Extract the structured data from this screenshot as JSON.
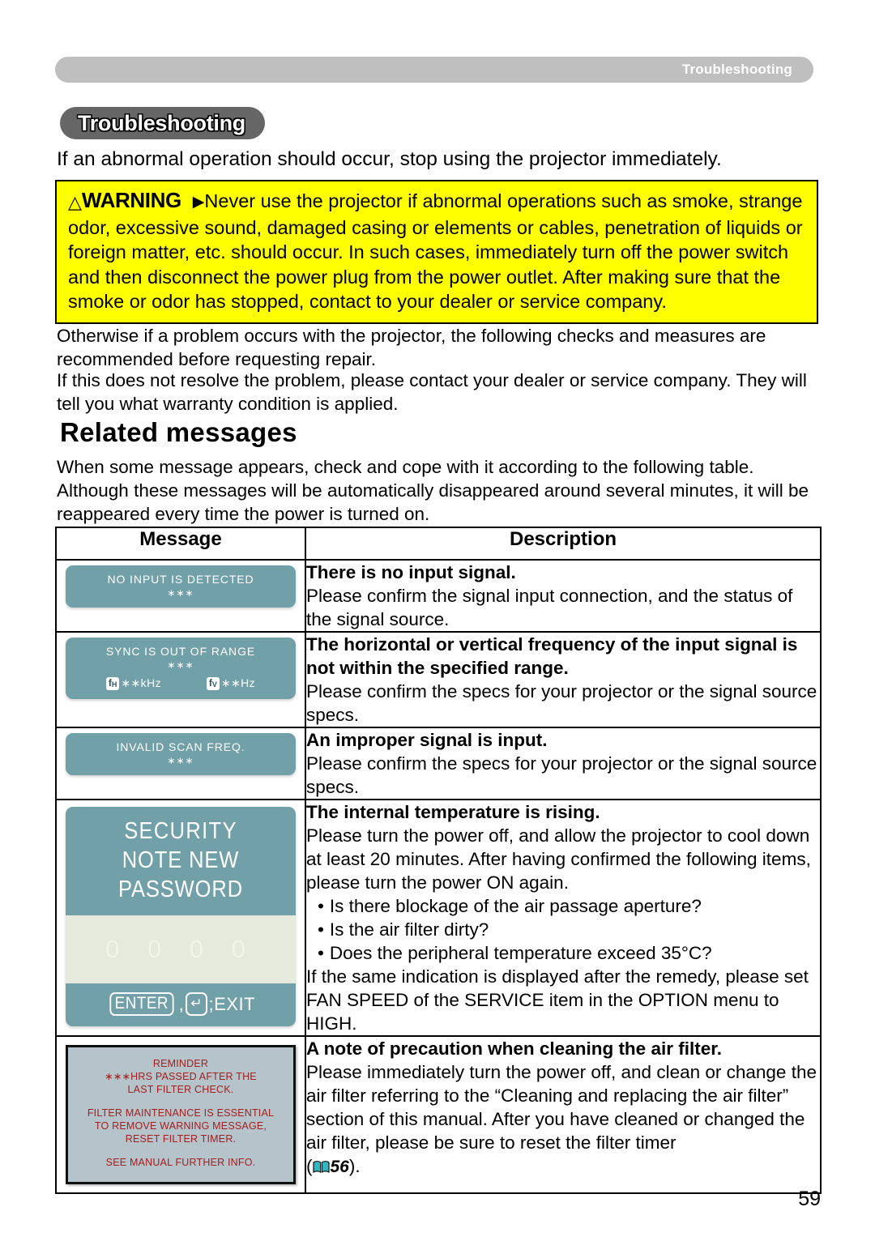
{
  "running_header": {
    "label": "Troubleshooting"
  },
  "section": {
    "title": "Troubleshooting",
    "intro": "If an abnormal operation should occur, stop using the projector immediately."
  },
  "warning": {
    "triangle_icon": "warning-triangle-icon",
    "label": "WARNING",
    "arrow_icon": "right-triangle-icon",
    "text": "Never use the projector if abnormal operations such as smoke, strange odor, excessive sound, damaged casing or elements or cables, penetration of liquids or foreign matter, etc. should occur. In such cases, immediately turn off the power switch and then disconnect the power plug from the power outlet. After making sure that the smoke or odor has stopped, contact to your dealer or service company.",
    "background_color": "#ffff00",
    "border_color": "#000000"
  },
  "paragraphs": {
    "p1": "Otherwise if a problem occurs with the projector, the following checks and measures are recommended before requesting repair.",
    "p2": "If this does not resolve the problem, please contact your dealer or service company. They will tell you what warranty condition is applied.",
    "p3": "When some message appears, check and cope with it according to the following table. Although these messages will be automatically disappeared around several minutes, it will be reappeared every time the power is turned on."
  },
  "related_messages": {
    "heading": "Related messages",
    "table": {
      "headers": [
        "Message",
        "Description"
      ],
      "rows": [
        {
          "osd": {
            "type": "simple",
            "line1": "NO INPUT IS DETECTED",
            "stars": "∗∗∗"
          },
          "desc_title": "There is no input signal.",
          "desc_body": "Please confirm the signal input connection, and the status of the signal source."
        },
        {
          "osd": {
            "type": "freq",
            "line1": "SYNC IS OUT OF RANGE",
            "stars": "∗∗∗",
            "fh_label": "f",
            "fh_sub": "H",
            "fh_value": "∗∗kHz",
            "fv_label": "f",
            "fv_sub": "V",
            "fv_value": "∗∗Hz"
          },
          "desc_title": "The horizontal or vertical frequency of the input signal is not within the specified range.",
          "desc_body": "Please confirm the specs for your projector or the signal source specs."
        },
        {
          "osd": {
            "type": "simple",
            "line1": "INVALID SCAN FREQ.",
            "stars": "∗∗∗"
          },
          "desc_title": "An improper signal is input.",
          "desc_body": "Please confirm the specs for your projector or the signal source specs."
        },
        {
          "osd": {
            "type": "security",
            "title": "SECURITY",
            "subtitle": "NOTE NEW PASSWORD",
            "digits": "0 0 0 0",
            "key_enter": "ENTER",
            "key_separator": ",",
            "key_return_icon": "return-arrow-icon",
            "key_exit": ";EXIT"
          },
          "desc_title": "The internal temperature is rising.",
          "desc_body": "Please turn the power off, and allow the projector to cool down at least 20 minutes. After having confirmed the following items, please turn the power ON again.",
          "desc_bullets": [
            "Is there blockage of the air passage aperture?",
            "Is the air filter dirty?",
            "Does the peripheral temperature exceed 35°C?"
          ],
          "desc_footer": "If the same indication is displayed after the remedy, please set FAN SPEED of the SERVICE item in the OPTION menu to HIGH."
        },
        {
          "osd": {
            "type": "reminder",
            "lines_block1": [
              "REMINDER",
              "∗∗∗HRS PASSED AFTER THE",
              "LAST FILTER CHECK."
            ],
            "lines_block2": [
              "FILTER MAINTENANCE IS ESSENTIAL",
              "TO REMOVE WARNING MESSAGE,",
              "RESET FILTER TIMER."
            ],
            "lines_block3": [
              "SEE MANUAL FURTHER INFO."
            ]
          },
          "desc_title": "A note of precaution when cleaning the air filter.",
          "desc_body_a": "Please immediately turn the power off, and clean or change the air filter referring to the “Cleaning and replacing the air filter” section of this manual. After you have cleaned or changed the air filter, please be sure to reset the filter timer",
          "desc_ref_open": "(",
          "desc_ref_icon": "book-icon",
          "desc_ref_page": "56",
          "desc_ref_close": ")."
        }
      ]
    }
  },
  "footer": {
    "page_number": "59"
  },
  "colors": {
    "osd_teal": "#72a0a8",
    "osd_cream": "#e6eadd",
    "reminder_bg": "#b4c4ca",
    "reminder_text": "#a51f1f",
    "header_gray": "#bfbfbf",
    "title_pill_gray": "#666666",
    "warning_yellow": "#ffff00",
    "book_icon_teal": "#35b5bd"
  }
}
